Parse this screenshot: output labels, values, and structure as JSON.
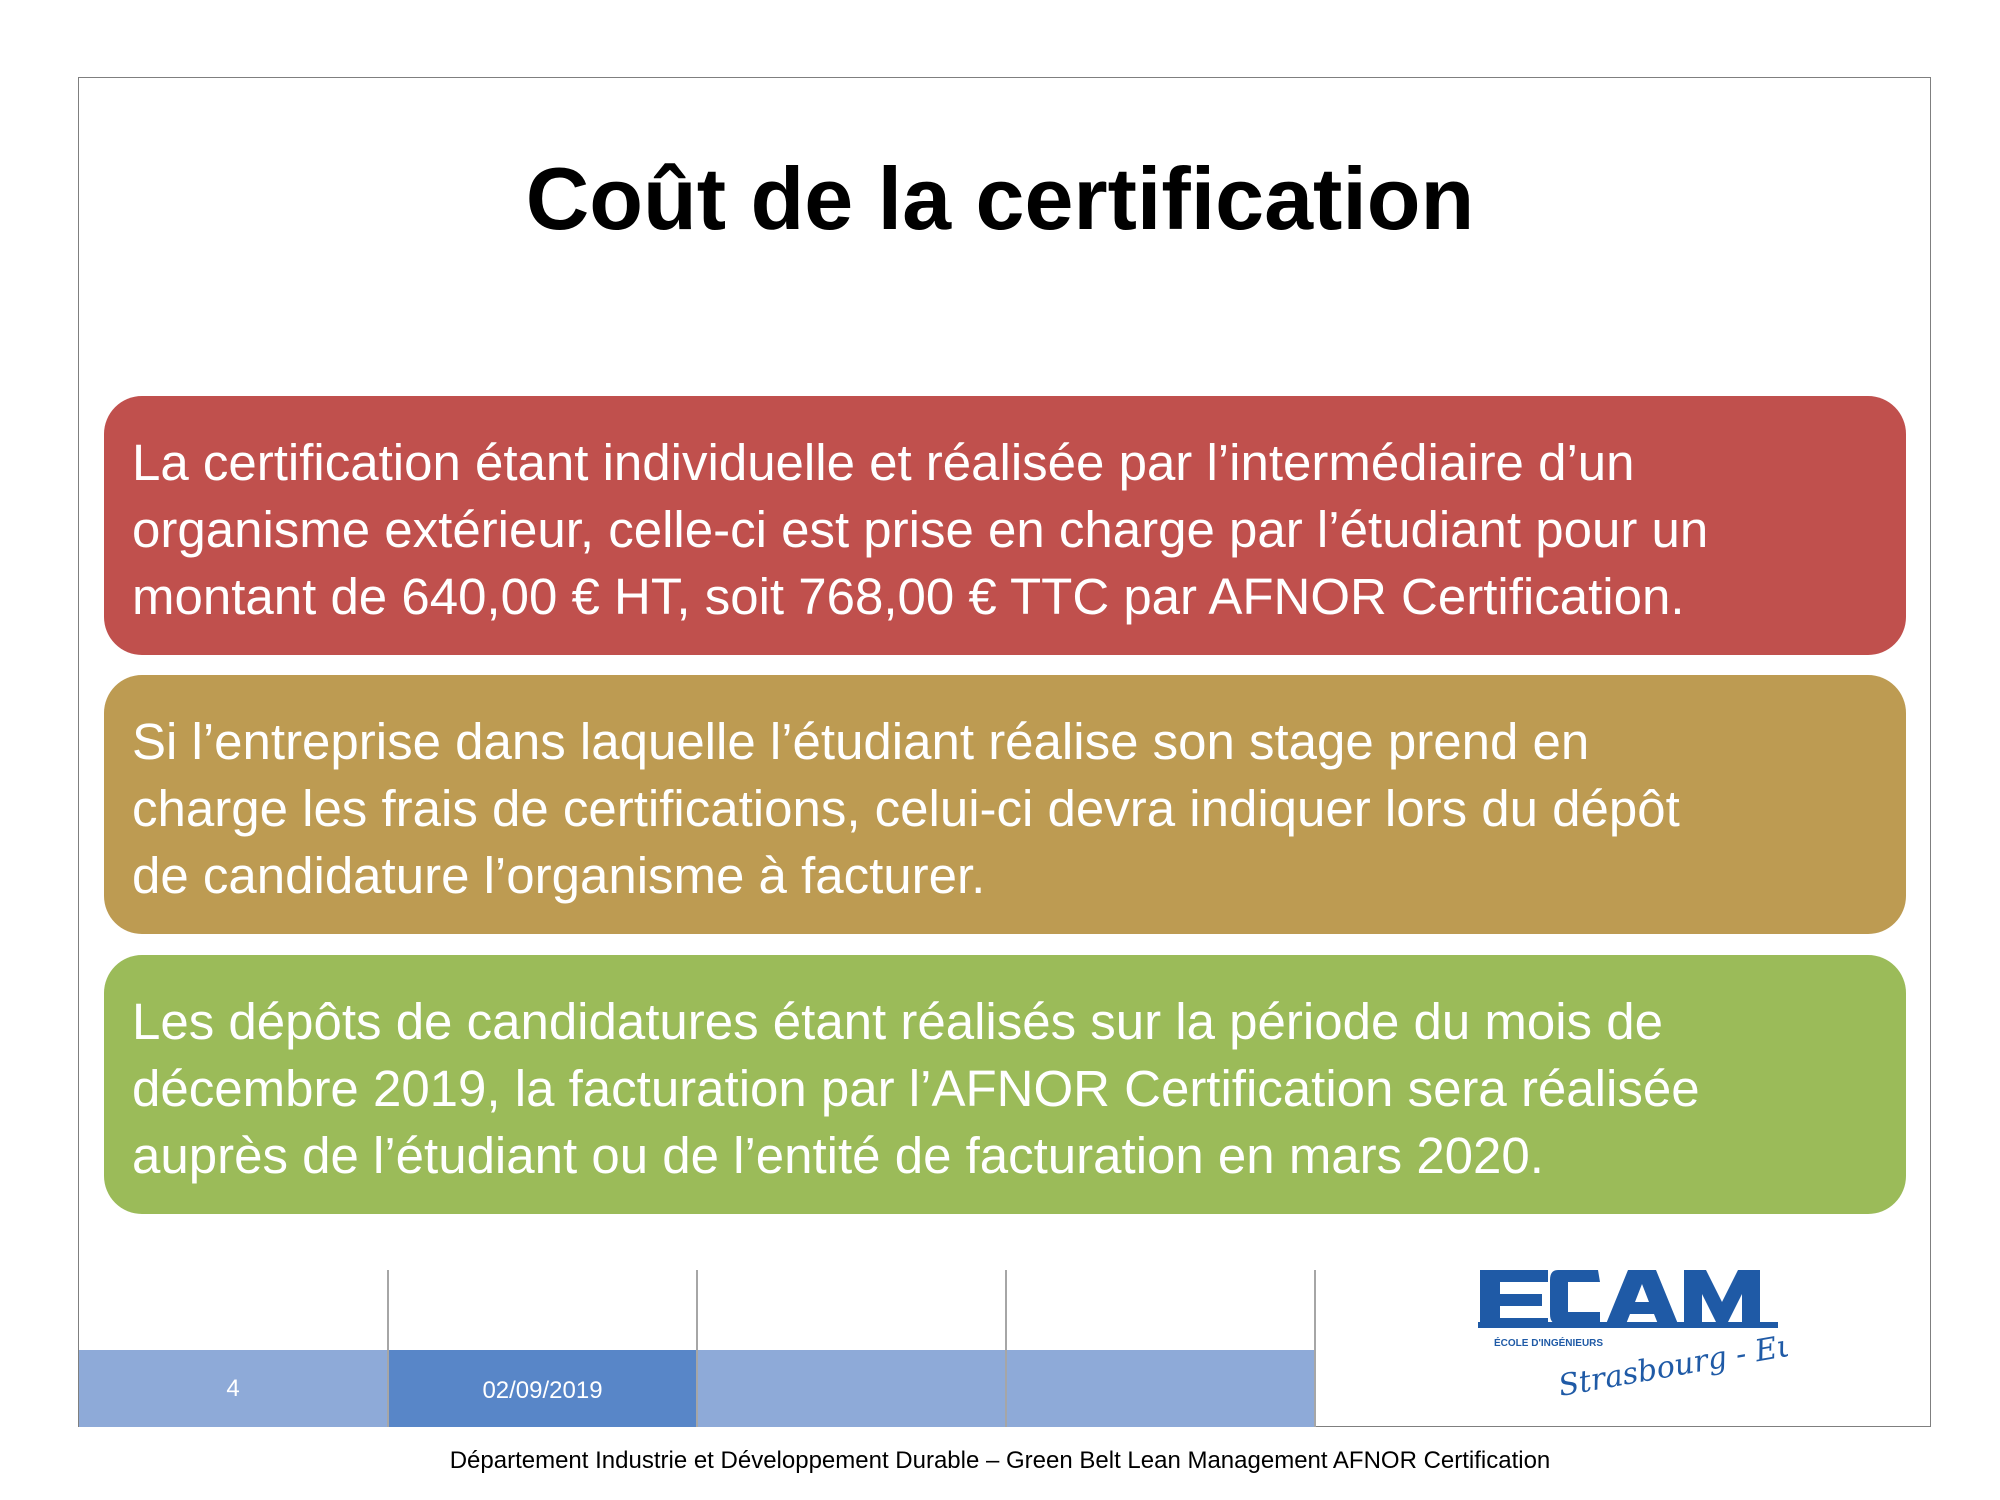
{
  "slide": {
    "title": "Coût de la certification",
    "boxes": [
      {
        "lines": [
          "La certification étant individuelle et réalisée par l’intermédiaire d’un",
          "organisme extérieur, celle-ci est prise en charge par l’étudiant pour un",
          "montant de 640,00 € HT, soit 768,00 € TTC par AFNOR Certification."
        ],
        "color": "#c0504d"
      },
      {
        "lines": [
          "Si l’entreprise dans laquelle l’étudiant réalise son stage prend en",
          "charge les frais de certifications, celui-ci devra indiquer lors du dépôt",
          "de candidature l’organisme à facturer."
        ],
        "color": "#bd9b52"
      },
      {
        "lines": [
          "Les dépôts de candidatures étant réalisés sur la période du mois de",
          "décembre 2019, la facturation par l’AFNOR Certification sera réalisée",
          "auprès de l’étudiant ou de l’entité de facturation en mars 2020."
        ],
        "color": "#9bbb59"
      }
    ]
  },
  "footer": {
    "page_number": "4",
    "date": "02/09/2019",
    "caption": "Département Industrie et Développement Durable – Green Belt Lean Management AFNOR Certification"
  },
  "logo": {
    "wordmark": "ECAM",
    "subtitle": "ÉCOLE D'INGÉNIEURS",
    "signature": "Strasbourg - Europe",
    "color": "#1f5aa6"
  }
}
